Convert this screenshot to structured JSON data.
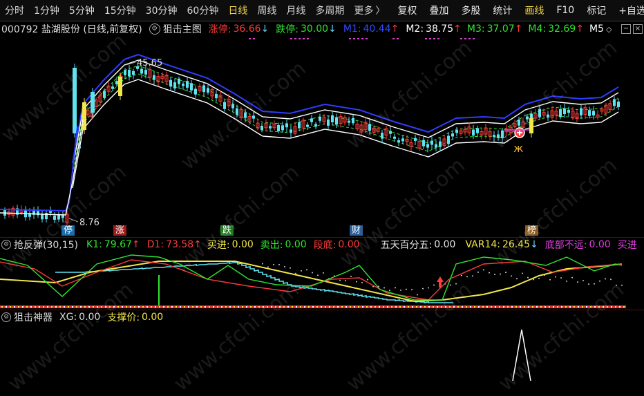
{
  "toolbar": {
    "periods": [
      "分时",
      "1分钟",
      "5分钟",
      "15分钟",
      "30分钟",
      "60分钟",
      "日线",
      "周线",
      "月线",
      "多周期",
      "更多"
    ],
    "more_arrow": "〉",
    "actions": [
      "复权",
      "叠加",
      "多股",
      "统计",
      "画线",
      "F10",
      "标记",
      "+自选"
    ]
  },
  "info": {
    "stock": "000792 盐湖股份 (日线,前复权)",
    "template": "狙击主图",
    "zhangting_label": "涨停:",
    "zhangting_val": "36.66",
    "dieting_label": "跌停:",
    "dieting_val": "30.00",
    "m1_label": "M1:",
    "m1_val": "40.44",
    "m2_label": "M2:",
    "m2_val": "38.75",
    "m3_label": "M3:",
    "m3_val": "37.07",
    "m4_label": "M4:",
    "m4_val": "32.69",
    "m5_label": "M5",
    "arrow_up": "↑",
    "arrow_down": "↓"
  },
  "main_chart": {
    "high_label": "45.65",
    "low_label": "8.76",
    "tags": [
      "停",
      "涨",
      "跌",
      "财",
      "榜"
    ]
  },
  "panel2": {
    "name": "抢反弹(30,15)",
    "k1_label": "K1:",
    "k1_val": "79.67",
    "d1_label": "D1:",
    "d1_val": "73.58",
    "buy_label": "买进:",
    "buy_val": "0.00",
    "sell_label": "卖出:",
    "sell_val": "0.00",
    "bottom_label": "段底:",
    "bottom_val": "0.00",
    "five_label": "五天百分五:",
    "five_val": "0.00",
    "var14_label": "VAR14:",
    "var14_val": "26.45",
    "near_label": "底部不远:",
    "near_val": "0.00",
    "buy_into": "买进"
  },
  "panel3": {
    "name": "狙击神器",
    "xg_label": "XG:",
    "xg_val": "0.00",
    "support_label": "支撑价:",
    "support_val": "0.00"
  },
  "watermark": "www.cfchi.com",
  "colors": {
    "red": "#ff3b3b",
    "green": "#2ee62e",
    "blue": "#2f4bff",
    "cyan": "#5fe3f0",
    "yellow": "#f2e64a",
    "magenta": "#e040e0",
    "white": "#ffffff"
  }
}
